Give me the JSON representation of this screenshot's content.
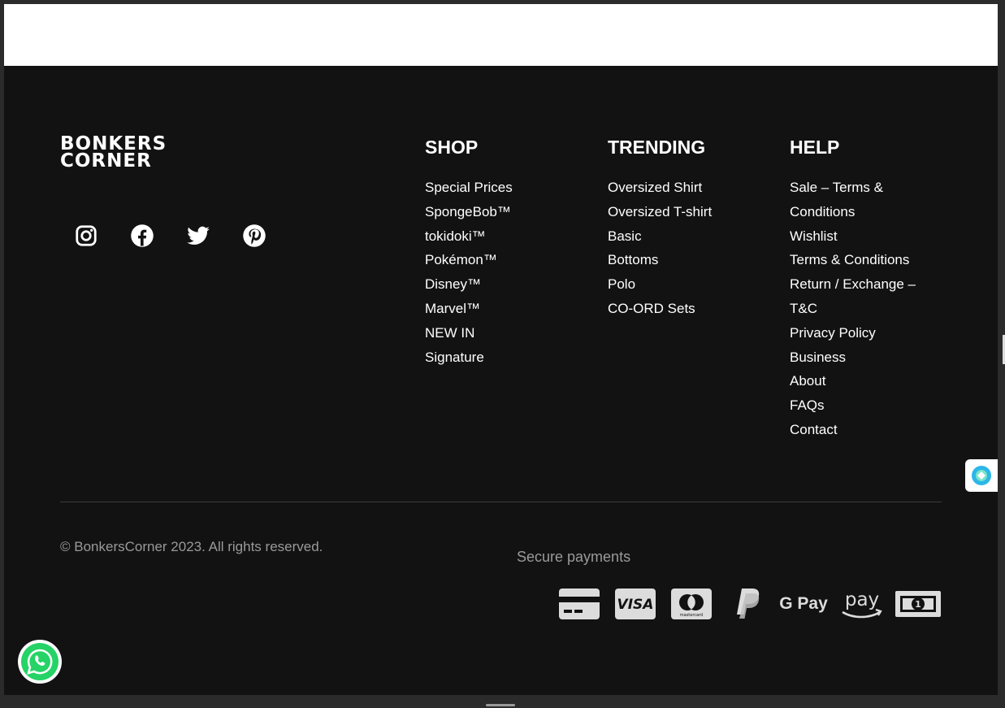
{
  "brand": {
    "line1": "BONKERS",
    "line2": "CORNER"
  },
  "social": [
    "instagram-icon",
    "facebook-icon",
    "twitter-icon",
    "pinterest-icon"
  ],
  "shop": {
    "title": "SHOP",
    "items": [
      "Special Prices",
      "SpongeBob™",
      "tokidoki™",
      "Pokémon™",
      "Disney™",
      "Marvel™",
      "NEW IN",
      "Signature"
    ]
  },
  "trending": {
    "title": "TRENDING",
    "items": [
      "Oversized Shirt",
      "Oversized T-shirt",
      "Basic",
      "Bottoms",
      "Polo",
      "CO-ORD Sets"
    ]
  },
  "help": {
    "title": "HELP",
    "items": [
      "Sale – Terms &",
      "Conditions",
      "Wishlist",
      "Terms & Conditions",
      "Return / Exchange –",
      "T&C",
      "Privacy Policy",
      "Business",
      "About",
      "FAQs",
      "Contact"
    ]
  },
  "copyright": "© BonkersCorner 2023. All rights reserved.",
  "secure_payments": "Secure payments",
  "payments": {
    "icons": [
      "card-icon",
      "visa-icon",
      "mastercard-icon",
      "paypal-icon",
      "google-pay-icon",
      "amazon-pay-icon",
      "cash-icon"
    ],
    "visa_text": "VISA",
    "mastercard_text": "mastercard",
    "gpay_text": "G Pay",
    "amazon_text": "pay",
    "cash_text": "1"
  },
  "colors": {
    "footer_bg": "#121212",
    "text": "#ffffff",
    "muted": "#9a9a9a",
    "whatsapp": "#25d366"
  }
}
